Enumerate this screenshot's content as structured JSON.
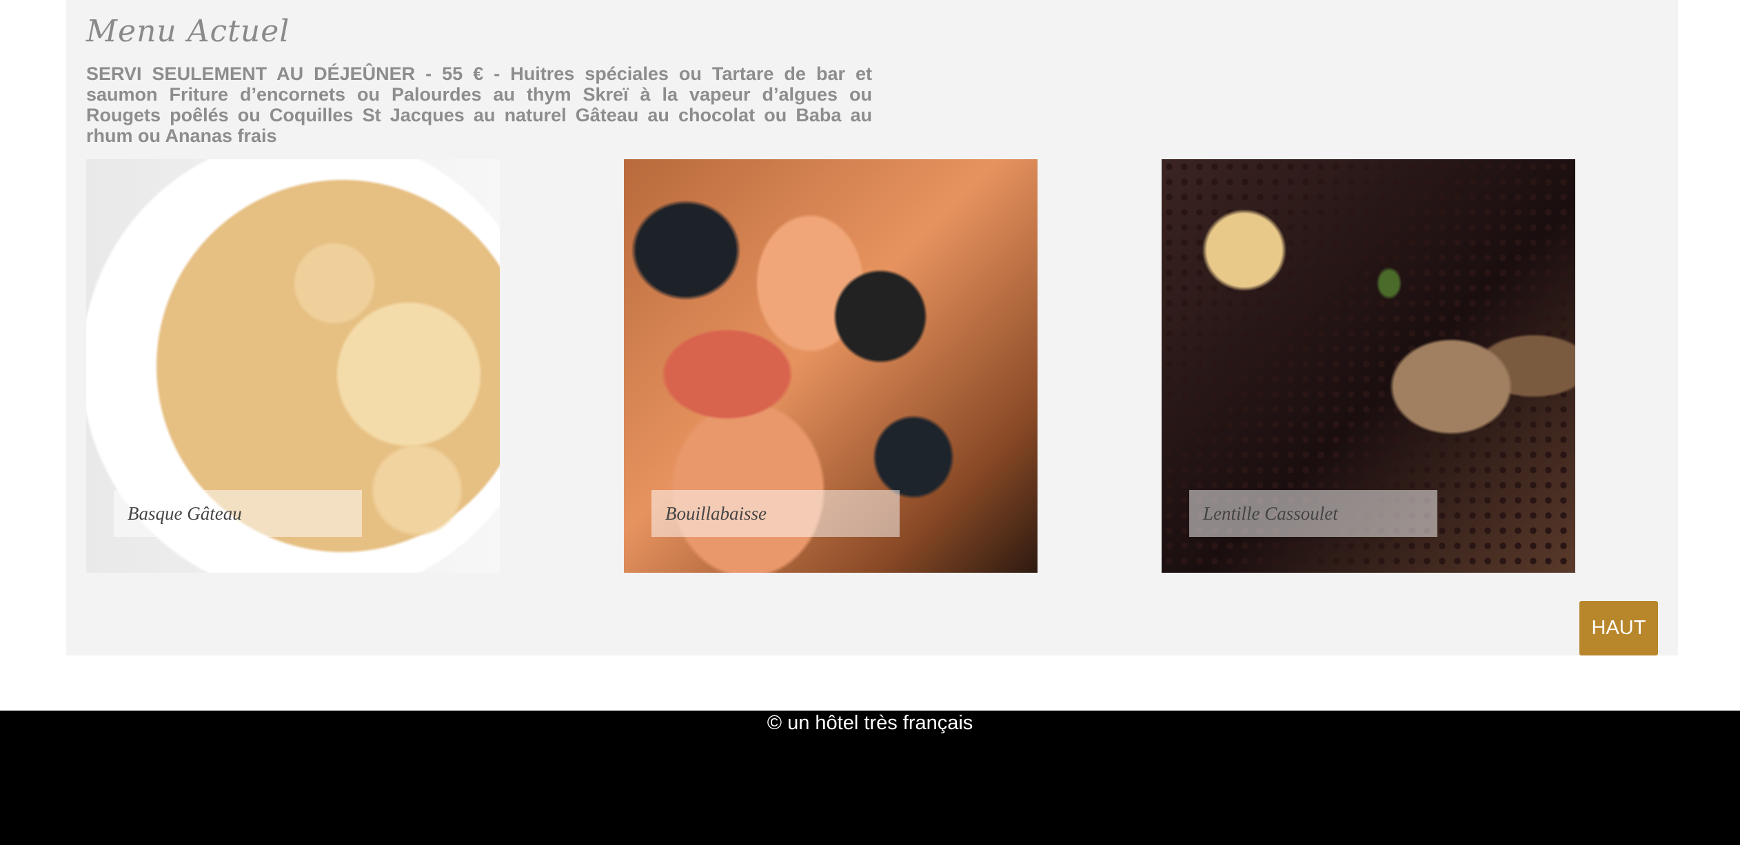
{
  "menu": {
    "title": "Menu Actuel",
    "description": "SERVI SEULEMENT AU DÉJEÛNER - 55 € - Huitres spéciales ou Tartare de bar et saumon Friture d’encornets ou Palourdes au thym Skreï à la vapeur d’algues ou Rougets poêlés ou Coquilles St Jacques au naturel Gâteau au chocolat ou Baba au rhum ou Ananas frais"
  },
  "dishes": [
    {
      "caption": "Basque Gâteau"
    },
    {
      "caption": "Bouillabaisse"
    },
    {
      "caption": "Lentille Cassoulet"
    }
  ],
  "buttons": {
    "haut_label": "HAUT"
  },
  "footer": {
    "copyright": "© un hôtel très français"
  },
  "colors": {
    "accent": "#b8862b",
    "panel_background": "#f3f3f3",
    "footer_background": "#000000"
  }
}
